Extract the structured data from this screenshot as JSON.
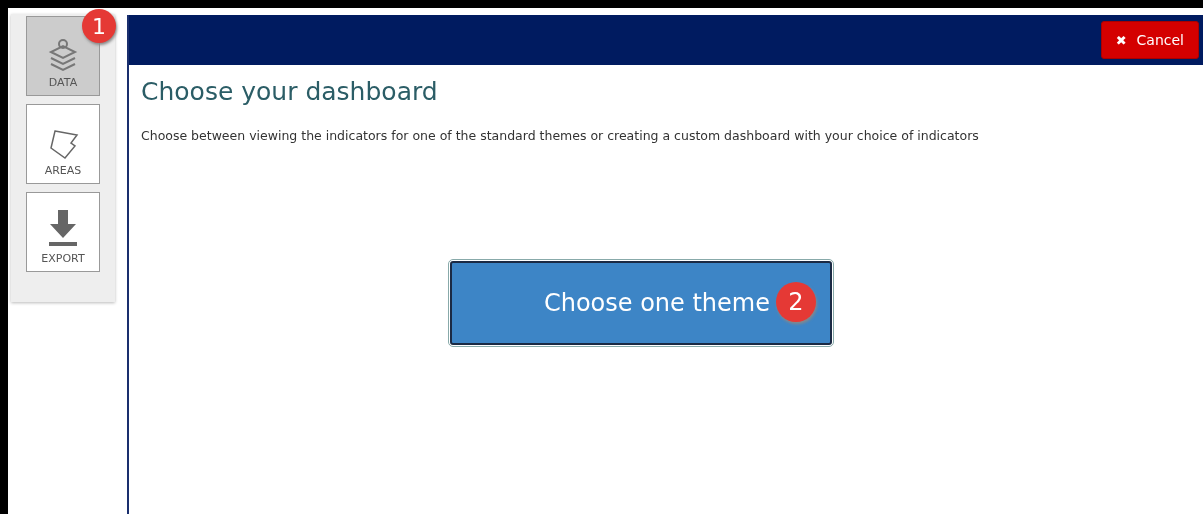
{
  "sidebar": {
    "items": [
      {
        "label": "DATA",
        "kind": "layers",
        "selected": true,
        "badge": "1"
      },
      {
        "label": "AREAS",
        "kind": "polygon",
        "selected": false
      },
      {
        "label": "EXPORT",
        "kind": "download",
        "selected": false
      }
    ]
  },
  "header": {
    "cancel_button": "Cancel",
    "cancel_icon": "✖"
  },
  "title": "Choose your dashboard",
  "description": "Choose between viewing the indicators for one of the standard themes or creating a custom dashboard with your choice of indicators",
  "main_button": {
    "label": "Choose one theme",
    "badge": "2"
  }
}
